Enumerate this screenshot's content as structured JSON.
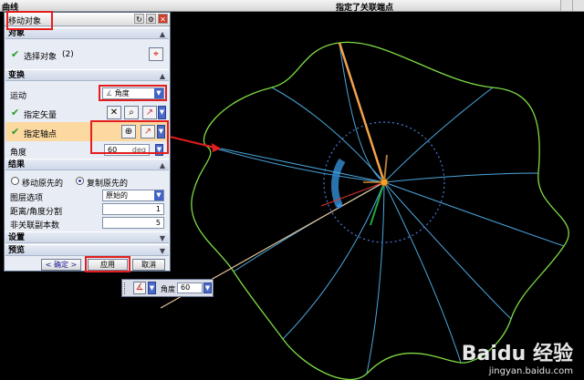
{
  "window": {
    "left_title": "曲线",
    "center_title": "指定了关联端点"
  },
  "dialog": {
    "title": "移动对象",
    "sections": {
      "object": "对象",
      "transform": "变换",
      "result": "结果",
      "settings": "设置",
      "preview": "预览"
    },
    "select_object_label": "选择对象",
    "select_object_count": "(2)",
    "motion_label": "运动",
    "motion_value": "角度",
    "vector_label": "指定矢量",
    "axis_point_label": "指定轴点",
    "angle_label": "角度",
    "angle_value": "60",
    "angle_unit": "deg",
    "radio_move_label": "移动原先的",
    "radio_copy_label": "复制原先的",
    "layer_label": "图层选项",
    "layer_value": "原始的",
    "distance_label": "距离/角度分割",
    "distance_value": "1",
    "copies_label": "非关联副本数",
    "copies_value": "5",
    "buttons": {
      "ok": "< 确定 >",
      "apply": "应用",
      "cancel": "取消"
    }
  },
  "floatbar": {
    "angle_label": "角度",
    "angle_value": "60"
  },
  "watermark": {
    "brand": "Baidu 经验",
    "url": "jingyan.baidu.com"
  },
  "colors": {
    "curve": "#7fdc44",
    "spoke": "#4ba6dc",
    "highlight": "#fcd9a0",
    "annotation": "#e41d1d",
    "selected_line": "#f2a24e"
  }
}
